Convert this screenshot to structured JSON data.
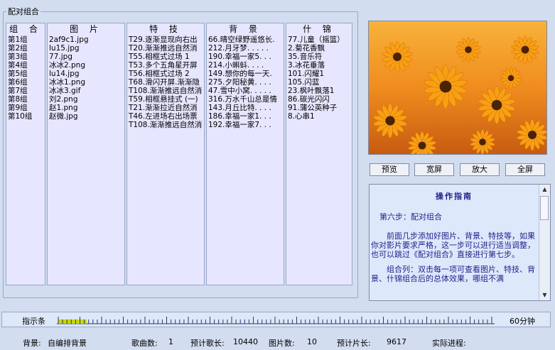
{
  "group_title": "配对组合",
  "columns": {
    "group": "组 合",
    "image": "图 片",
    "effect": "特 技",
    "background": "背 景",
    "assorted": "什 锦"
  },
  "rows": [
    {
      "group": "第1组",
      "image": "2af9c1.jpg",
      "effect": "T29.逐渐显现向右出",
      "background": "66.晴空绿野遥悠长.",
      "assorted": "77.儿童（摇篮）"
    },
    {
      "group": "第2组",
      "image": "lu15.jpg",
      "effect": "T20.渐渐推远自然消",
      "background": "212.月牙梦. . . . .",
      "assorted": "2.菊花香飘"
    },
    {
      "group": "第3组",
      "image": "77.jpg",
      "effect": "T55.相框式过场 1",
      "background": "190.幸福一家5. . .",
      "assorted": "35.音乐符"
    },
    {
      "group": "第4组",
      "image": "冰冰2.png",
      "effect": "T53.多个五角星开屏",
      "background": "214.小蝌蚪. . . .",
      "assorted": "3.冰花垂落"
    },
    {
      "group": "第5组",
      "image": "lu14.jpg",
      "effect": "T56.相框式过场 2",
      "background": "149.想你的每一天.",
      "assorted": "101.闪耀1"
    },
    {
      "group": "第6组",
      "image": "冰冰1.png",
      "effect": "T68.滑闪开屏.渐渐隐",
      "background": "275.夕阳秘黄. . . .",
      "assorted": "105.闪蓝"
    },
    {
      "group": "第7组",
      "image": "冰冰3.gif",
      "effect": "T108.渐渐推远自然消",
      "background": "47.雪中小窝. . . . .",
      "assorted": "23.枫叶飘落1"
    },
    {
      "group": "第8组",
      "image": "刘2.png",
      "effect": "T59.相框悬挂式 (一)",
      "background": "316.万水千山总是情",
      "assorted": "86.碳光闪闪"
    },
    {
      "group": "第9组",
      "image": "赵1.png",
      "effect": "T21.渐渐拉近自然消",
      "background": "143.月丘比特. . . .",
      "assorted": "91.蒲公英种子"
    },
    {
      "group": "第10组",
      "image": "赵微.jpg",
      "effect": "T46.左进场右出场票",
      "background": "186.幸福一家1. . .",
      "assorted": "8.心串1"
    },
    {
      "group": "",
      "image": "",
      "effect": "T108.渐渐推远自然消",
      "background": "192.幸福一家7. . .",
      "assorted": ""
    }
  ],
  "buttons": {
    "preview": "预览",
    "wide": "宽屏",
    "zoom": "放大",
    "fullscreen": "全屏"
  },
  "guide": {
    "title": "操作指南",
    "step": "第六步：配对组合",
    "p1": "前面几步添加好图片、背景、特技等，如果你对影片要求严格，这一步可以进行适当调整，也可以跳过《配对组合》直接进行第七步。",
    "p2": "组合列：双击每一项可查看图片、特技、背景、什锦组合后的总体效果，哪组不满"
  },
  "indicator": {
    "label": "指示条",
    "end_label": "60分钟",
    "progress_fraction": 0.065
  },
  "status": {
    "bg_label": "背景:",
    "bg_value": "自编排背景",
    "songs_label": "歌曲数:",
    "songs_value": "1",
    "est_song_label": "预计歌长:",
    "est_song_value": "10440",
    "images_label": "图片数:",
    "images_value": "10",
    "est_film_label": "预计片长:",
    "est_film_value": "9617",
    "progress_label": "实际进程:"
  },
  "colors": {
    "panel": "#d2ddf0",
    "list": "#e6e6ff",
    "guide_text": "#22228a",
    "progress": "#c8d800"
  }
}
